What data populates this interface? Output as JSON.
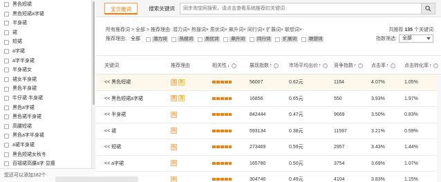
{
  "left_list": {
    "items": [
      "黑色短裙",
      "黑色短裙a字裙",
      "半身裙",
      "裙",
      "短裙",
      "a字裙",
      "a字半身裙",
      "半身裙女",
      "裙女半身裙",
      "黑色半身裙",
      "牛仔裙 半身裙",
      "黑色a字裙",
      "黑色裙半身裙",
      "高腰短裙",
      "黑色a字半身裙",
      "a裙半身裙",
      "黑色短裙女秋冬",
      "百褶裙高腰a字 显瘦"
    ],
    "footer": "您还可以添加182个"
  },
  "tabs": {
    "active": "宝贝推词",
    "other": "搜索关键词"
  },
  "search": {
    "placeholder": "同步淘宝网搜索，请点击查看系统推荐的关键词"
  },
  "filters": {
    "breadcrumb": "所有推荐词 > 全部 > 推荐理由: 潜力词× 热搜词× 质优词× 飙升词× 同行词× 扩展词× 联想词×",
    "total_prefix": "共推荐",
    "total_count": "135",
    "total_suffix": "个关键词",
    "reason_label": "推荐理由:",
    "reason_all": "全部",
    "reasons": [
      "潜力词",
      "热搜词",
      "质优词",
      "飙升词",
      "同行词",
      "扩展词",
      "联想词"
    ],
    "index_label": "指数筛选:",
    "index_value": "全部"
  },
  "table": {
    "headers": {
      "keyword": "关键词",
      "reason": "推荐理由",
      "relevance": "相关性",
      "impressions": "展现指数",
      "avg_bid": "市场平均出价",
      "competition": "竞争指数",
      "ctr": "点击率",
      "cvr": "点击转化率"
    },
    "rows": [
      {
        "keyword": "<< 黑色短裙",
        "tags": [
          "潜",
          "质"
        ],
        "impressions": "56007",
        "avg_bid": "0.62元",
        "competition": "1164",
        "ctr": "4.07%",
        "cvr": "1.05%"
      },
      {
        "keyword": "<< 黑色短裙a字裙",
        "tags": [
          "质",
          "潜"
        ],
        "impressions": "16856",
        "avg_bid": "0.65元",
        "competition": "550",
        "ctr": "3.93%",
        "cvr": "1.97%"
      },
      {
        "keyword": "<< 半身裙",
        "tags": [
          "热"
        ],
        "impressions": "842444",
        "avg_bid": "0.47元",
        "competition": "9669",
        "ctr": "3.50%",
        "cvr": "0.83%"
      },
      {
        "keyword": "<< 裙",
        "tags": [
          "热"
        ],
        "impressions": "593134",
        "avg_bid": "0.38元",
        "competition": "11597",
        "ctr": "3.21%",
        "cvr": "0.59%"
      },
      {
        "keyword": "<< 短裙",
        "tags": [
          "热"
        ],
        "impressions": "273469",
        "avg_bid": "0.59元",
        "competition": "2957",
        "ctr": "3.43%",
        "cvr": "1.44%"
      },
      {
        "keyword": "<< a字裙",
        "tags": [
          "热"
        ],
        "impressions": "165780",
        "avg_bid": "0.50元",
        "competition": "3754",
        "ctr": "3.69%",
        "cvr": "1.07%"
      },
      {
        "keyword": "<< a字半身裙",
        "tags": [
          "热"
        ],
        "impressions": "304740",
        "avg_bid": "0.49元",
        "competition": "4104",
        "ctr": "3.83%",
        "cvr": "1.15%"
      }
    ]
  },
  "colors": {
    "accent": "#ff7a00",
    "row_highlight": "#fdf7ec"
  }
}
